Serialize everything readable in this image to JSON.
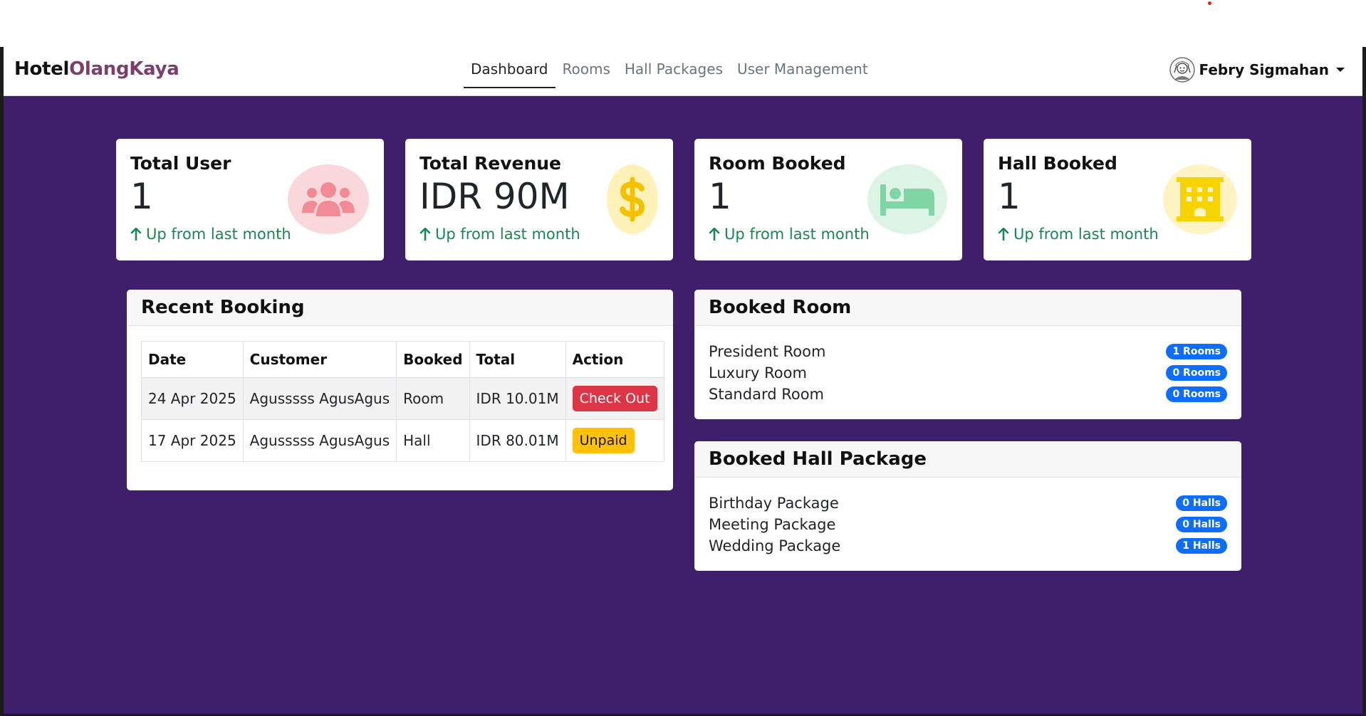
{
  "brand": {
    "part1": "Hotel",
    "part2": "OlangKaya"
  },
  "nav": [
    "Dashboard",
    "Rooms",
    "Hall Packages",
    "User Management"
  ],
  "user": {
    "name": "Febry Sigmahan"
  },
  "stats": [
    {
      "title": "Total User",
      "value": "1",
      "trend": "Up from last month",
      "icon": "users-icon"
    },
    {
      "title": "Total Revenue",
      "value": "IDR 90M",
      "trend": "Up from last month",
      "icon": "dollar-icon"
    },
    {
      "title": "Room Booked",
      "value": "1",
      "trend": "Up from last month",
      "icon": "bed-icon"
    },
    {
      "title": "Hall Booked",
      "value": "1",
      "trend": "Up from last month",
      "icon": "building-icon"
    }
  ],
  "recent_booking": {
    "title": "Recent Booking",
    "headers": [
      "Date",
      "Customer",
      "Booked",
      "Total",
      "Action"
    ],
    "rows": [
      {
        "date": "24 Apr 2025",
        "customer": "Agusssss AgusAgus",
        "booked": "Room",
        "total": "IDR 10.01M",
        "action": "Check Out"
      },
      {
        "date": "17 Apr 2025",
        "customer": "Agusssss AgusAgus",
        "booked": "Hall",
        "total": "IDR 80.01M",
        "action": "Unpaid"
      }
    ]
  },
  "booked_room": {
    "title": "Booked Room",
    "items": [
      {
        "label": "President Room",
        "badge": "1 Rooms"
      },
      {
        "label": "Luxury Room",
        "badge": "0 Rooms"
      },
      {
        "label": "Standard Room",
        "badge": "0 Rooms"
      }
    ]
  },
  "booked_hall": {
    "title": "Booked Hall Package",
    "items": [
      {
        "label": "Birthday Package",
        "badge": "0 Halls"
      },
      {
        "label": "Meeting Package",
        "badge": "0 Halls"
      },
      {
        "label": "Wedding Package",
        "badge": "1 Halls"
      }
    ]
  },
  "colors": {
    "background": "#3f1f6b",
    "brand_accent": "#7a3f6b",
    "success": "#198754",
    "danger": "#dc3545",
    "warning": "#ffc107",
    "badge": "#0d6efd"
  }
}
